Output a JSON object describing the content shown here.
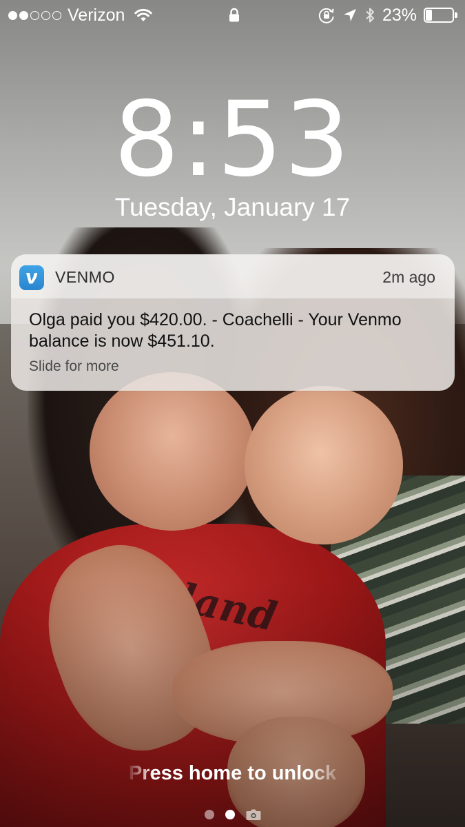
{
  "status_bar": {
    "signal_bars": 2,
    "signal_total": 5,
    "carrier": "Verizon",
    "wifi_icon": "wifi-icon",
    "lock_icon": "padlock-icon",
    "orientation_lock_icon": "orientation-lock-icon",
    "location_icon": "location-arrow-icon",
    "bluetooth_icon": "bluetooth-icon",
    "battery_percent": "23%",
    "battery_level": 0.23
  },
  "lock_screen": {
    "time": "8:53",
    "date": "Tuesday, January 17",
    "unlock_hint": "Press home to unlock"
  },
  "notification": {
    "app_icon": "venmo-icon",
    "app_icon_letter": "V",
    "app_name": "VENMO",
    "time_ago": "2m ago",
    "message": "Olga paid you $420.00. - Coachelli - Your Venmo balance is now $451.10.",
    "action_hint": "Slide for more",
    "accent_color": "#3D95CE"
  },
  "page_indicator": {
    "pages": 2,
    "active_page": 2,
    "camera_icon": "camera-icon"
  },
  "wallpaper": {
    "description_icon": "photo-wallpaper",
    "shirt_text": "eyland"
  }
}
